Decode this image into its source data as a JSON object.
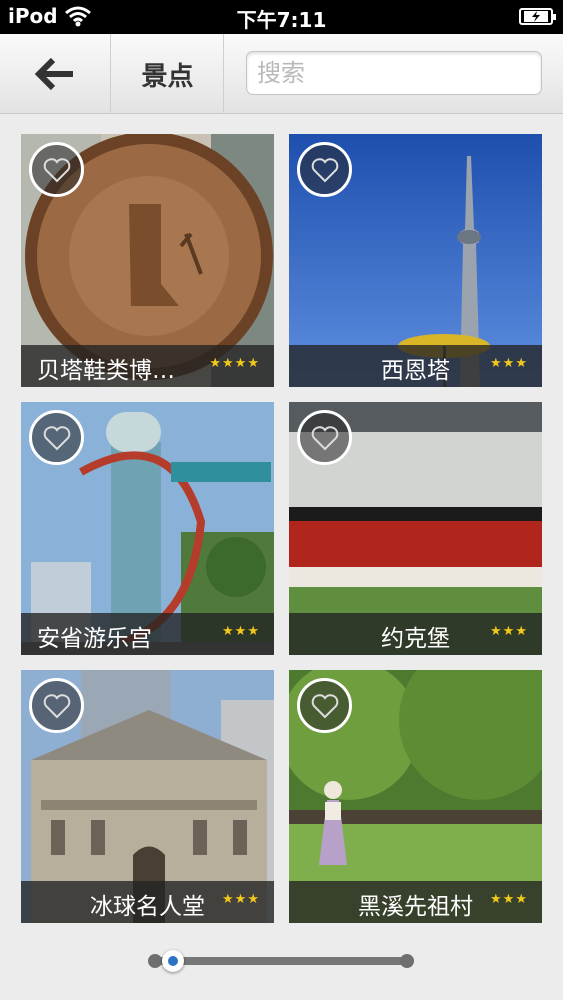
{
  "status_bar": {
    "carrier": "iPod",
    "time": "下午7:11"
  },
  "header": {
    "title": "景点",
    "search_placeholder": "搜索"
  },
  "attractions": [
    {
      "name": "贝塔鞋类博…",
      "stars": "★★★★"
    },
    {
      "name": "西恩塔",
      "stars": "★★★"
    },
    {
      "name": "安省游乐宫",
      "stars": "★★★"
    },
    {
      "name": "约克堡",
      "stars": "★★★"
    },
    {
      "name": "冰球名人堂",
      "stars": "★★★"
    },
    {
      "name": "黑溪先祖村",
      "stars": "★★★"
    }
  ],
  "pager": {
    "current_page": 1,
    "total_pages": 2
  },
  "colors": {
    "star": "#f3c81c",
    "pager_active": "#2c73c7"
  }
}
